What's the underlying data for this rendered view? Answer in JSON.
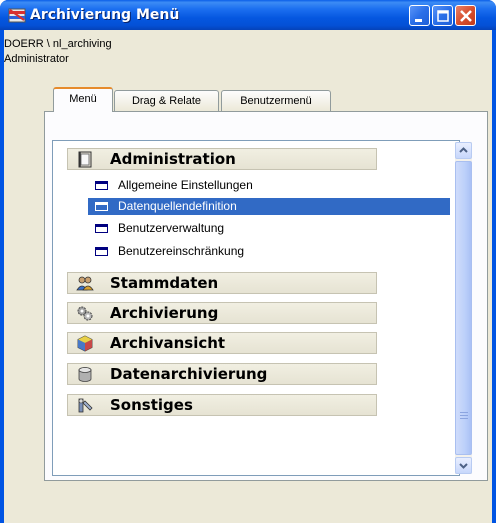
{
  "window": {
    "title": "Archivierung Menü"
  },
  "user": {
    "path": "DOERR \\ nl_archiving",
    "role": "Administrator"
  },
  "tabs": [
    {
      "label": "Menü",
      "active": true
    },
    {
      "label": "Drag & Relate",
      "active": false
    },
    {
      "label": "Benutzermenü",
      "active": false
    }
  ],
  "menu": {
    "groups": [
      {
        "label": "Administration",
        "icon": "book-icon",
        "expanded": true,
        "items": [
          {
            "label": "Allgemeine Einstellungen",
            "selected": false
          },
          {
            "label": "Datenquellendefinition",
            "selected": true
          },
          {
            "label": "Benutzerverwaltung",
            "selected": false
          },
          {
            "label": "Benutzereinschränkung",
            "selected": false
          }
        ]
      },
      {
        "label": "Stammdaten",
        "icon": "users-icon",
        "expanded": false
      },
      {
        "label": "Archivierung",
        "icon": "gears-icon",
        "expanded": false
      },
      {
        "label": "Archivansicht",
        "icon": "cube-icon",
        "expanded": false
      },
      {
        "label": "Datenarchivierung",
        "icon": "database-icon",
        "expanded": false
      },
      {
        "label": "Sonstiges",
        "icon": "tools-icon",
        "expanded": false
      }
    ]
  },
  "colors": {
    "titlebar": "#0054e3",
    "selection": "#316ac5",
    "client_bg": "#ece9d8",
    "group_header_bg": "#ece9d8",
    "item_icon": "#000080"
  }
}
